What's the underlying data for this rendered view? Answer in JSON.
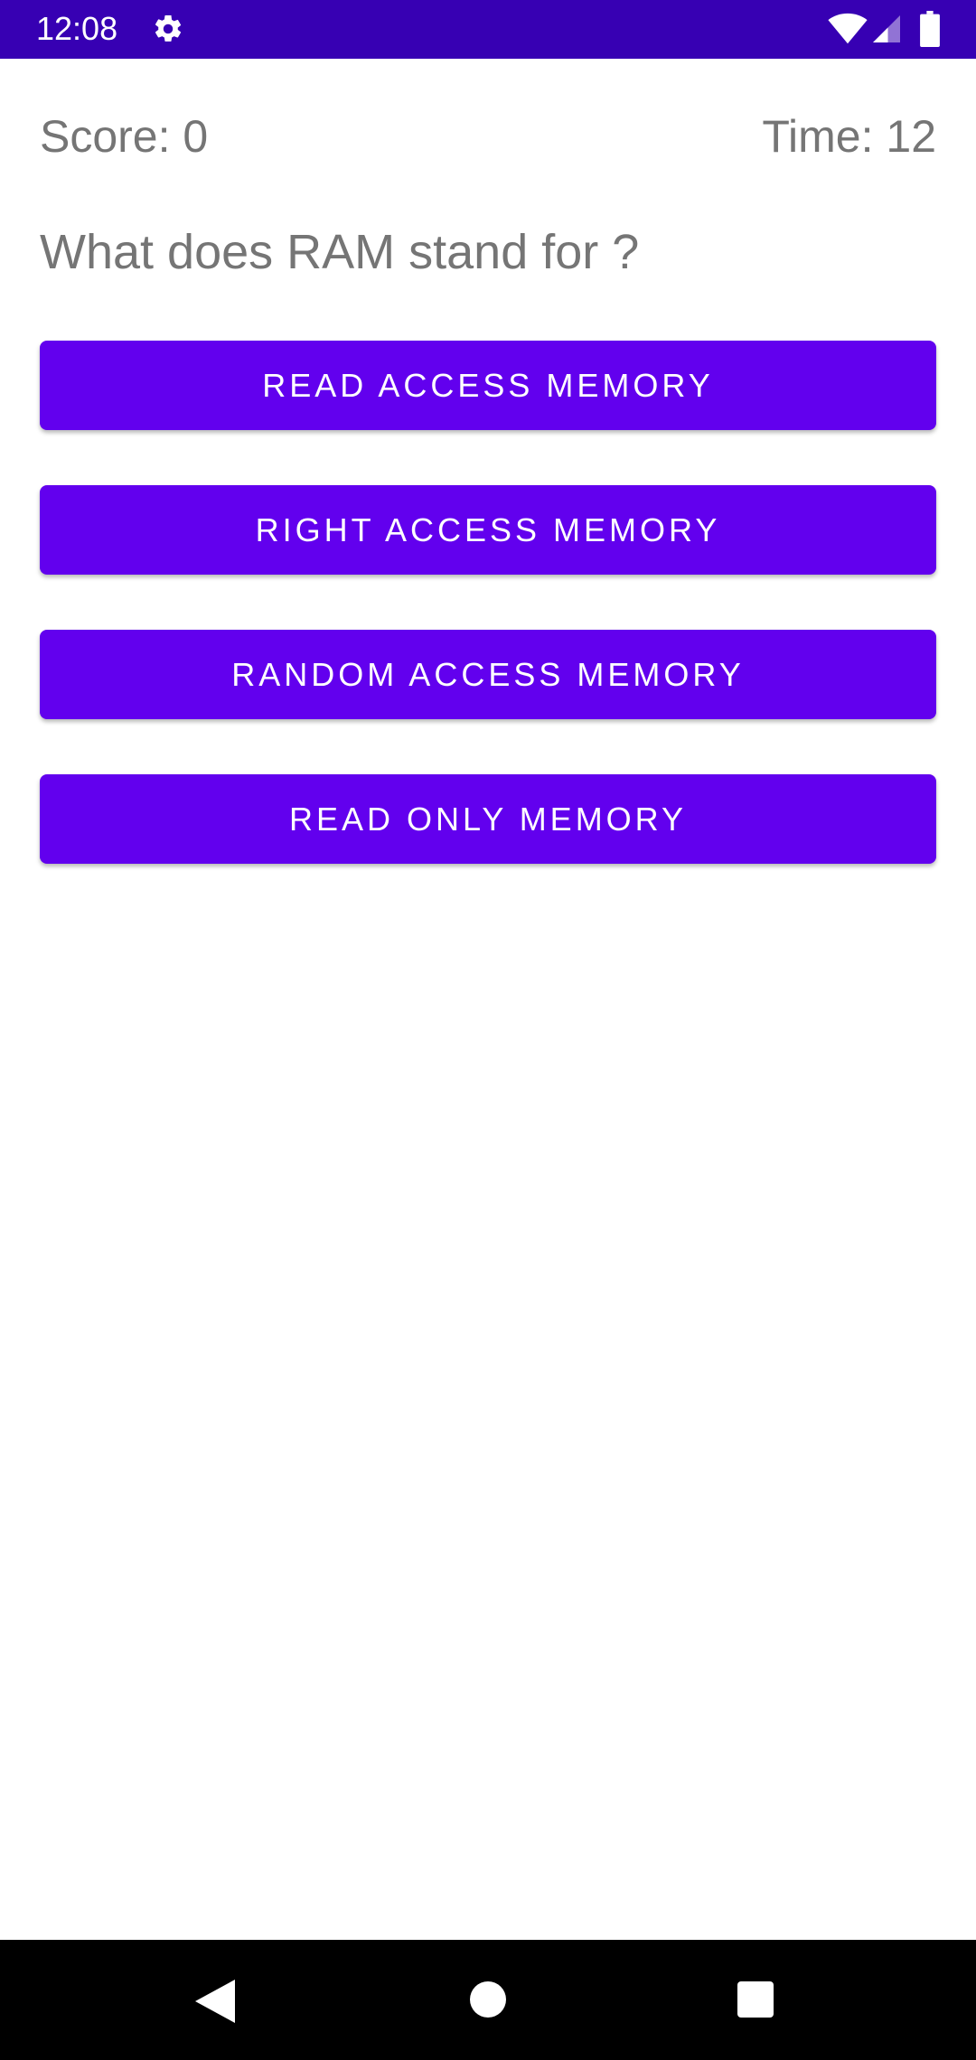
{
  "status_bar": {
    "time": "12:08",
    "icons": [
      "gear-icon",
      "wifi-icon",
      "signal-icon",
      "battery-icon"
    ],
    "background_color": "#3700b3"
  },
  "quiz": {
    "score_text": "Score: 0",
    "time_text": "Time: 12",
    "question": "What does RAM stand for ?",
    "answers": [
      "READ ACCESS MEMORY",
      "RIGHT ACCESS MEMORY",
      "RANDOM ACCESS MEMORY",
      "READ ONLY MEMORY"
    ],
    "button_color": "#6200ee",
    "text_color": "#757575"
  },
  "nav_bar": {
    "icons": [
      "back-icon",
      "home-icon",
      "recents-icon"
    ],
    "background_color": "#000000"
  }
}
